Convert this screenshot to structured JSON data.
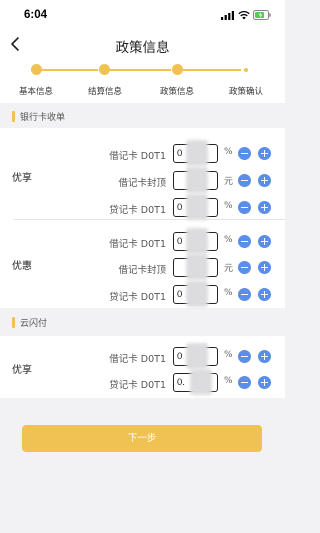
{
  "status_bar": {
    "time": "6:04"
  },
  "nav": {
    "title": "政策信息"
  },
  "steps": [
    {
      "label": "基本信息"
    },
    {
      "label": "结算信息"
    },
    {
      "label": "政策信息"
    },
    {
      "label": "政策确认"
    }
  ],
  "sections": {
    "bank": {
      "title": "银行卡收单"
    },
    "cloud": {
      "title": "云闪付"
    }
  },
  "groups": {
    "youxiang": {
      "label": "优享",
      "rows": [
        {
          "label": "借记卡 D0T1",
          "value": "0",
          "unit": "%"
        },
        {
          "label": "借记卡封顶",
          "value": "",
          "unit": "元"
        },
        {
          "label": "贷记卡 D0T1",
          "value": "0",
          "unit": "%"
        }
      ]
    },
    "youhui": {
      "label": "优惠",
      "rows": [
        {
          "label": "借记卡 D0T1",
          "value": "0",
          "unit": "%"
        },
        {
          "label": "借记卡封顶",
          "value": "",
          "unit": "元"
        },
        {
          "label": "贷记卡 D0T1",
          "value": "0",
          "unit": "%"
        }
      ]
    },
    "cloud_youxiang": {
      "label": "优享",
      "rows": [
        {
          "label": "借记卡 D0T1",
          "value": "0",
          "unit": "%"
        },
        {
          "label": "贷记卡 D0T1",
          "value": "0.",
          "unit": "%"
        }
      ]
    }
  },
  "footer": {
    "next_label": "下一步"
  },
  "colors": {
    "accent": "#f0c254",
    "button_blue": "#5b8ee8"
  }
}
